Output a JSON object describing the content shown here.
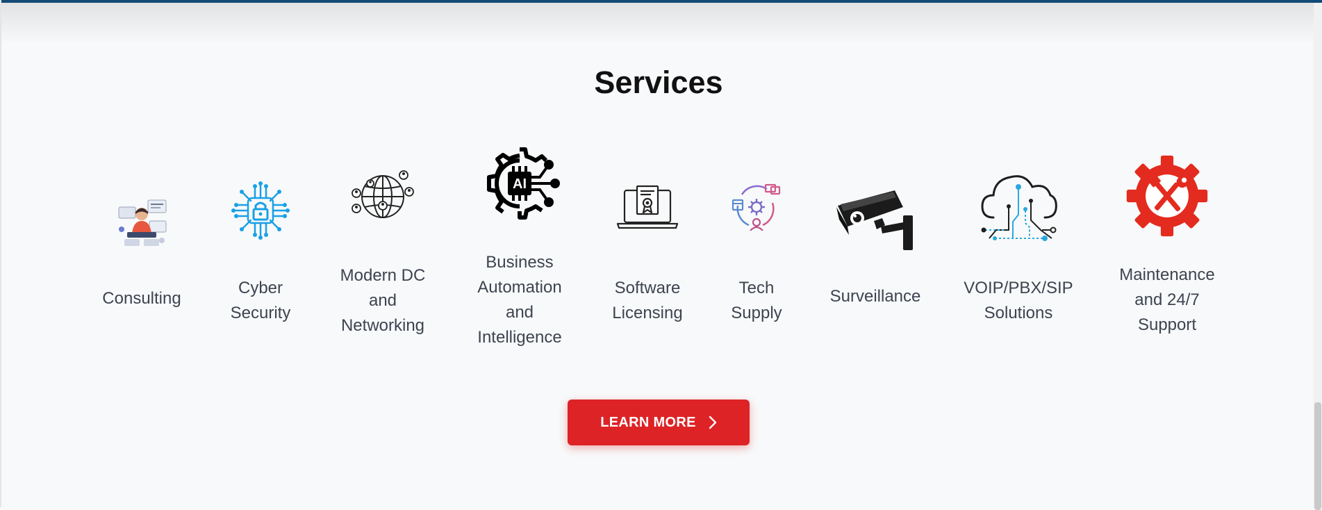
{
  "section": {
    "title": "Services"
  },
  "services": [
    {
      "label": "Consulting",
      "icon": "consultant-icon"
    },
    {
      "label": "Cyber\nSecurity",
      "icon": "circuit-lock-icon"
    },
    {
      "label": "Modern DC\nand\nNetworking",
      "icon": "globe-network-icon"
    },
    {
      "label": "Business\nAutomation\nand\nIntelligence",
      "icon": "ai-gear-icon"
    },
    {
      "label": "Software\nLicensing",
      "icon": "laptop-certificate-icon"
    },
    {
      "label": "Tech\nSupply",
      "icon": "supply-cycle-icon"
    },
    {
      "label": "Surveillance",
      "icon": "cctv-camera-icon"
    },
    {
      "label": "VOIP/PBX/SIP\nSolutions",
      "icon": "cloud-circuit-icon"
    },
    {
      "label": "Maintenance\nand 24/7\nSupport",
      "icon": "gear-tools-icon"
    }
  ],
  "cta": {
    "label": "LEARN MORE",
    "icon": "chevron-right-icon"
  },
  "colors": {
    "accent": "#dd2326",
    "top_bar": "#134a78",
    "background": "#f8f9fa",
    "text": "#3d4450"
  }
}
